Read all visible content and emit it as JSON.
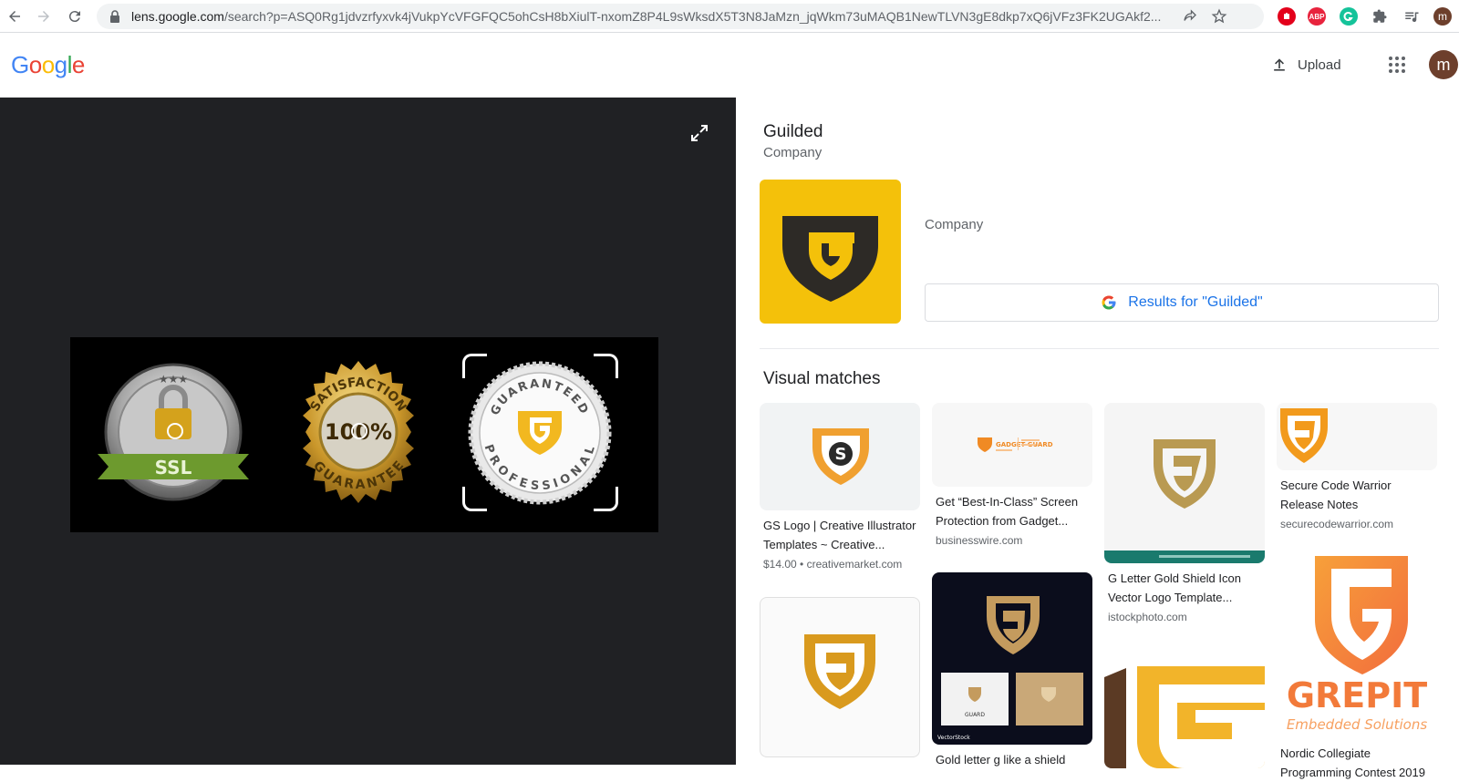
{
  "browser": {
    "url_host": "lens.google.com",
    "url_rest": "/search?p=ASQ0Rg1jdvzrfyxvk4jVukpYcVFGFQC5ohCsH8bXiulT-nxomZ8P4L9sWksdX5T3N8JaMzn_jqWkm73uMAQB1NewTLVN3gE8dkp7xQ6jVFz3FK2UGAkf2...",
    "ext_abp": "ABP"
  },
  "header": {
    "logo_letters": [
      "G",
      "o",
      "o",
      "g",
      "l",
      "e"
    ],
    "logo_colors": [
      "#4285f4",
      "#ea4335",
      "#fbbc05",
      "#4285f4",
      "#34a853",
      "#ea4335"
    ],
    "upload_label": "Upload",
    "avatar_letter": "m"
  },
  "image": {
    "badges": [
      {
        "name": "ssl-badge",
        "text": "SSL"
      },
      {
        "name": "satisfaction-badge",
        "top_text": "SATISFACTION",
        "center_text": "100%",
        "bottom_text": "GUARANTEE"
      },
      {
        "name": "professional-badge",
        "top_text": "GUARANTEED",
        "bottom_text": "PROFESSIONAL"
      }
    ]
  },
  "knowledge": {
    "title": "Guilded",
    "subtitle": "Company",
    "type_label": "Company",
    "results_button": "Results for \"Guilded\"",
    "brand_color": "#f4c10a"
  },
  "visual_matches": {
    "heading": "Visual matches",
    "items": [
      {
        "title": "GS Logo | Creative Illustrator Templates ~ Creative...",
        "source": "$14.00 • creativemarket.com"
      },
      {
        "title": "Get “Best-In-Class” Screen Protection from Gadget...",
        "source": "businesswire.com",
        "thumb_text": "GADGET GUARD"
      },
      {
        "title": "G Letter Gold Shield Icon Vector Logo Template...",
        "source": "istockphoto.com"
      },
      {
        "title": "Secure Code Warrior Release Notes",
        "source": "securecodewarrior.com"
      },
      {
        "title": "",
        "source": ""
      },
      {
        "title": "Gold letter g like a shield",
        "source": "",
        "thumb_text_top": "GUARD",
        "thumb_text_bottom": "VectorStock"
      },
      {
        "title": "",
        "source": ""
      },
      {
        "title": "Nordic Collegiate Programming Contest 2019",
        "source": "",
        "thumb_text_top": "GREPIT",
        "thumb_text_bottom": "Embedded Solutions"
      }
    ]
  }
}
